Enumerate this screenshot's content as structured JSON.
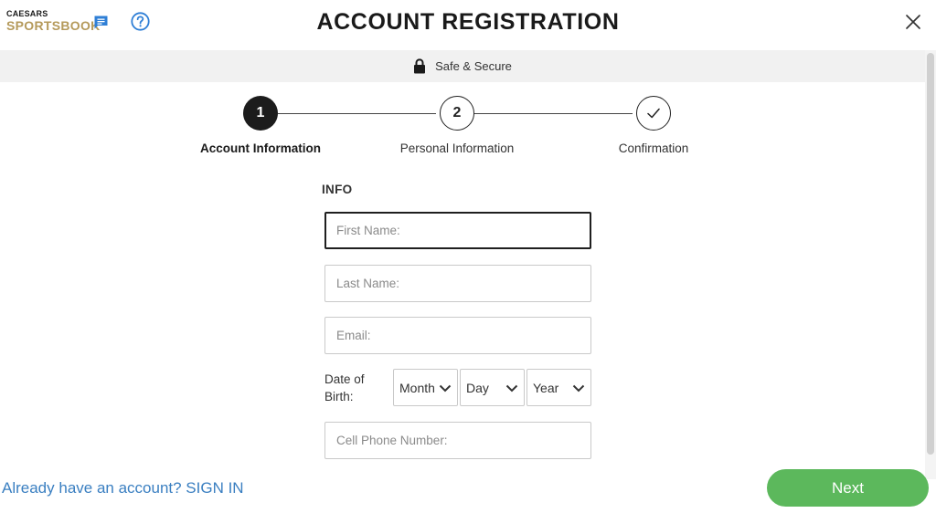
{
  "header": {
    "logo_top": "CAESARS",
    "logo_bottom": "SPORTSBOOK",
    "title": "ACCOUNT REGISTRATION",
    "icons": [
      "chat-icon",
      "help-icon",
      "close-icon"
    ]
  },
  "secure_bar": {
    "label": "Safe & Secure",
    "icon": "lock-icon"
  },
  "steps": [
    {
      "number": "1",
      "label": "Account Information",
      "state": "active"
    },
    {
      "number": "2",
      "label": "Personal Information",
      "state": "todo"
    },
    {
      "label": "Confirmation",
      "state": "todo",
      "icon": "checkmark-icon"
    }
  ],
  "form": {
    "section_title": "INFO",
    "first_name": {
      "placeholder": "First Name:",
      "value": ""
    },
    "last_name": {
      "placeholder": "Last Name:",
      "value": ""
    },
    "email": {
      "placeholder": "Email:",
      "value": ""
    },
    "dob": {
      "label": "Date of Birth:",
      "month": "Month",
      "day": "Day",
      "year": "Year"
    },
    "phone": {
      "placeholder": "Cell Phone Number:",
      "value": ""
    }
  },
  "footer": {
    "signin_text": "Already have an account? SIGN IN",
    "next_label": "Next"
  },
  "colors": {
    "brand_gold": "#b59a5b",
    "link_blue": "#3a7fc1",
    "icon_blue": "#2f7fd6",
    "next_green": "#5cb85c",
    "active_step": "#1c1c1c"
  }
}
